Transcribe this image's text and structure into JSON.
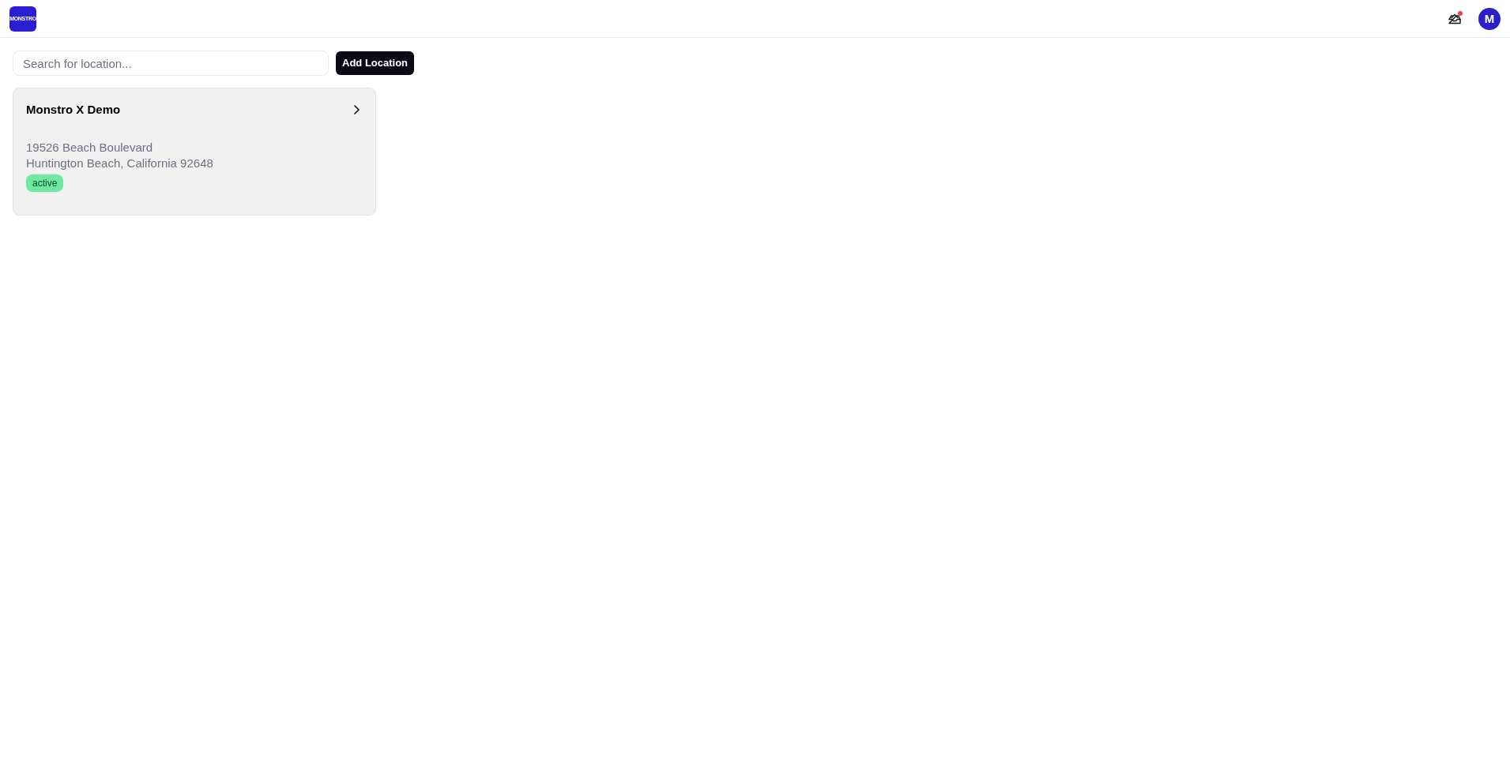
{
  "header": {
    "logo": {
      "text": "MONSTRO"
    },
    "notifications": {
      "unread": true
    },
    "avatar": {
      "initial": "M"
    }
  },
  "toolbar": {
    "search": {
      "placeholder": "Search for location..."
    },
    "add_button": "Add Location"
  },
  "locations": [
    {
      "name": "Monstro X Demo",
      "address_lines": [
        "19526 Beach Boulevard",
        "Huntington Beach, California 92648"
      ],
      "status": "active"
    }
  ]
}
